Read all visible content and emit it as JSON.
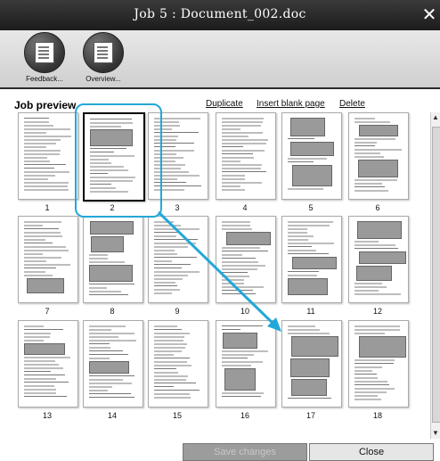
{
  "window": {
    "title": "Job 5 : Document_002.doc",
    "close_glyph": "✕"
  },
  "toolbar": {
    "feedback_label": "Feedback...",
    "overview_label": "Overview..."
  },
  "preview": {
    "title": "Job preview",
    "actions": [
      "Duplicate",
      "Insert blank page",
      "Delete"
    ],
    "pages": [
      "1",
      "2",
      "3",
      "4",
      "5",
      "6",
      "7",
      "8",
      "9",
      "10",
      "11",
      "12",
      "13",
      "14",
      "15",
      "16",
      "17",
      "18"
    ],
    "selected_page": "2"
  },
  "footer": {
    "save_label": "Save changes",
    "close_label": "Close"
  },
  "colors": {
    "highlight": "#22a8d8",
    "titlebar": "#2a2a2a"
  }
}
